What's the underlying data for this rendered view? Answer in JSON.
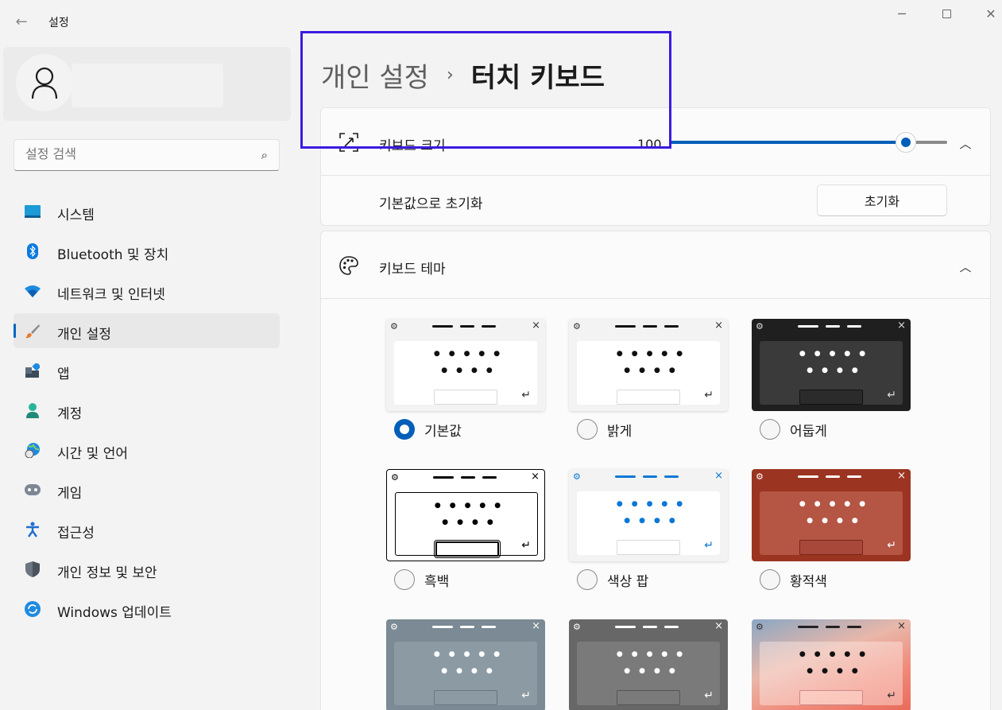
{
  "app": {
    "title": "설정",
    "back_icon": "arrow-left-icon"
  },
  "window_controls": {
    "minimize": "─",
    "close": "✕"
  },
  "search": {
    "placeholder": "설정 검색",
    "icon": "search-icon"
  },
  "sidebar": {
    "items": [
      {
        "label": "시스템",
        "icon": "system-icon"
      },
      {
        "label": "Bluetooth 및 장치",
        "icon": "bluetooth-icon"
      },
      {
        "label": "네트워크 및 인터넷",
        "icon": "wifi-icon"
      },
      {
        "label": "개인 설정",
        "icon": "brush-icon",
        "selected": true
      },
      {
        "label": "앱",
        "icon": "apps-icon"
      },
      {
        "label": "계정",
        "icon": "account-icon"
      },
      {
        "label": "시간 및 언어",
        "icon": "globe-clock-icon"
      },
      {
        "label": "게임",
        "icon": "gamepad-icon"
      },
      {
        "label": "접근성",
        "icon": "accessibility-icon"
      },
      {
        "label": "개인 정보 및 보안",
        "icon": "shield-icon"
      },
      {
        "label": "Windows 업데이트",
        "icon": "update-icon"
      }
    ]
  },
  "breadcrumb": {
    "parent": "개인 설정",
    "separator": "›",
    "current": "터치 키보드"
  },
  "keyboard_size": {
    "label": "키보드 크기",
    "value": "100",
    "slider_fraction": 0.85
  },
  "reset": {
    "label": "기본값으로 초기화",
    "button": "초기화"
  },
  "theme_section": {
    "label": "키보드 테마"
  },
  "themes": [
    {
      "label": "기본값",
      "checked": true
    },
    {
      "label": "밝게",
      "checked": false
    },
    {
      "label": "어둡게",
      "checked": false
    },
    {
      "label": "흑백",
      "checked": false
    },
    {
      "label": "색상 팝",
      "checked": false
    },
    {
      "label": "황적색",
      "checked": false
    }
  ],
  "colors": {
    "accent": "#005fb8",
    "highlight_box": "#3c1ae0"
  }
}
